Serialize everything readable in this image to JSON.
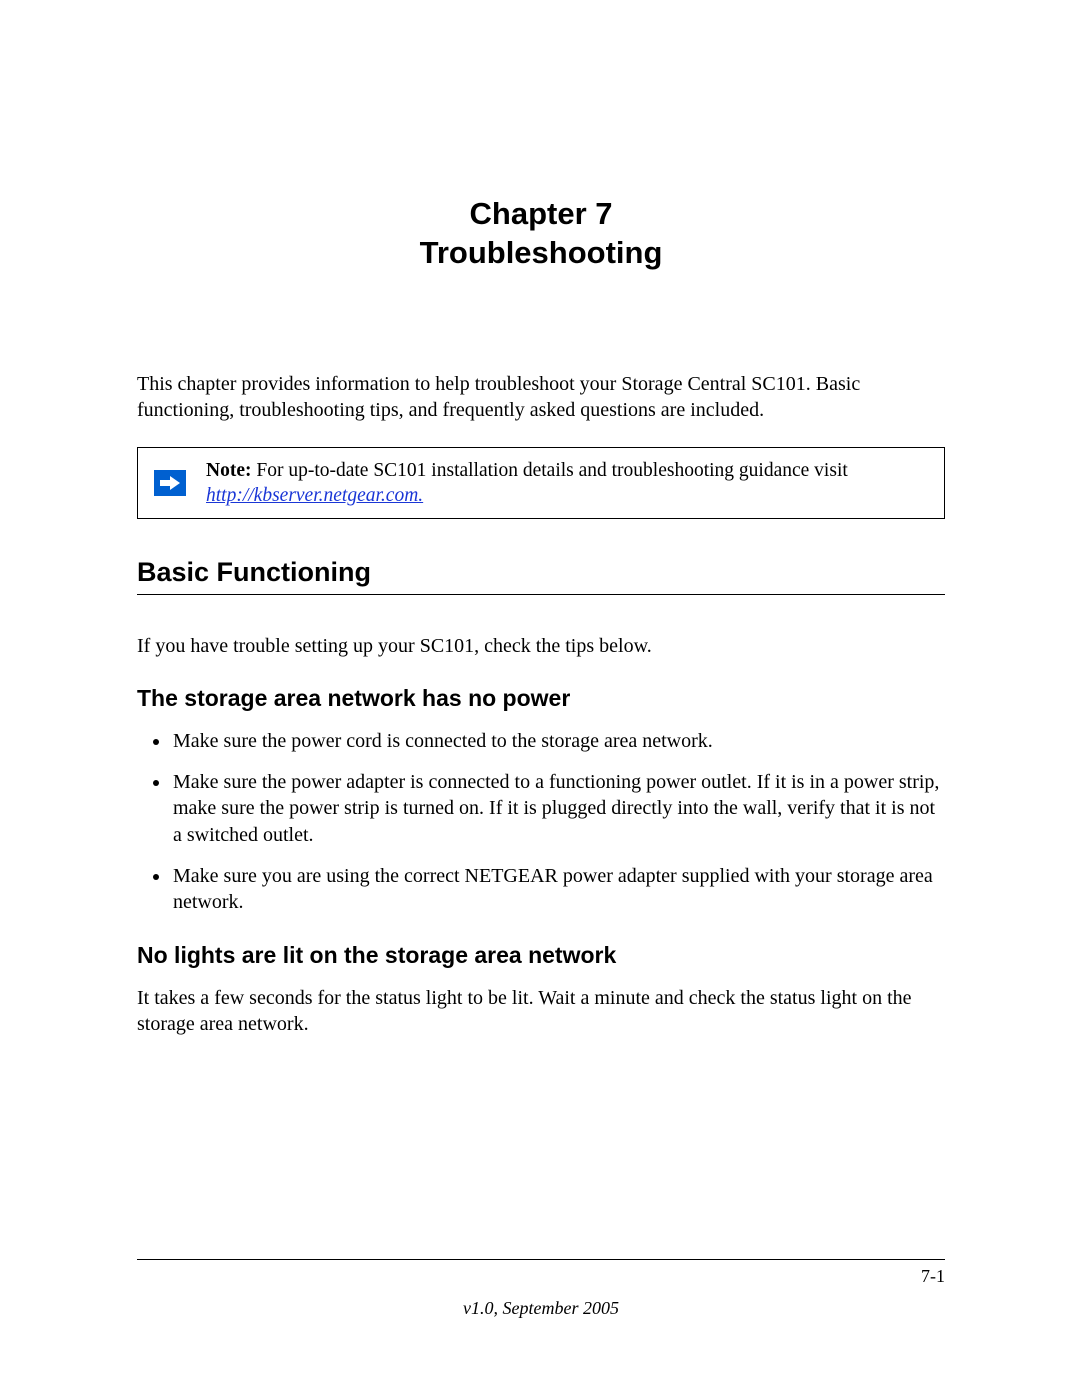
{
  "chapter": {
    "line1": "Chapter 7",
    "line2": "Troubleshooting"
  },
  "intro": "This chapter provides information to help troubleshoot your Storage Central SC101. Basic functioning, troubleshooting tips, and frequently asked questions are included.",
  "note": {
    "label": "Note:",
    "text": " For up-to-date SC101 installation details and troubleshooting guidance visit ",
    "link": "http://kbserver.netgear.com."
  },
  "section1": {
    "heading": "Basic Functioning",
    "body": "If you have trouble setting up your SC101, check the tips below."
  },
  "sub1": {
    "heading": "The storage area network has no power",
    "bullets": [
      "Make sure the power cord is connected to the storage area network.",
      "Make sure the power adapter is connected to a functioning power outlet. If it is in a power strip, make sure the power strip is turned on. If it is plugged directly into the wall, verify that it is not a switched outlet.",
      "Make sure you are using the correct NETGEAR power adapter supplied with your storage area network."
    ]
  },
  "sub2": {
    "heading": "No lights are lit on the storage area network",
    "body": "It takes a few seconds for the status light to be lit. Wait a minute and check the status light on the storage area network."
  },
  "footer": {
    "page": "7-1",
    "version": "v1.0, September 2005"
  }
}
